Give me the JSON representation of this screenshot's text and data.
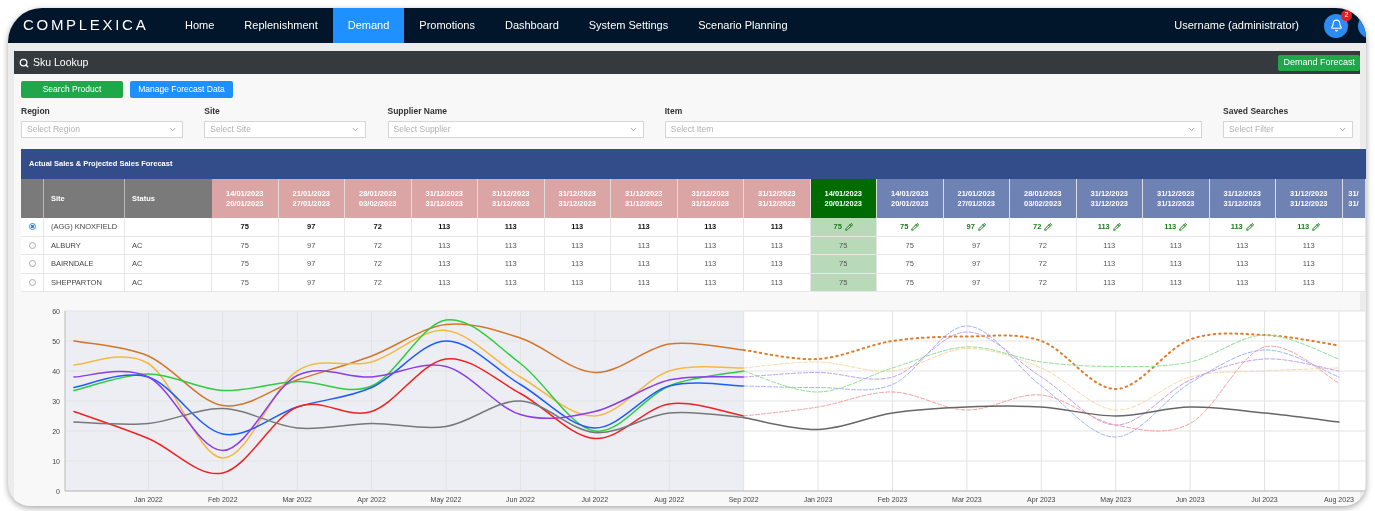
{
  "navbar": {
    "logo": "COMPLEXICA",
    "items": [
      {
        "label": "Home",
        "selected": false
      },
      {
        "label": "Replenishment",
        "selected": false
      },
      {
        "label": "Demand",
        "selected": true
      },
      {
        "label": "Promotions",
        "selected": false
      },
      {
        "label": "Dashboard",
        "selected": false
      },
      {
        "label": "System Settings",
        "selected": false
      },
      {
        "label": "Scenario Planning",
        "selected": false
      }
    ],
    "user": "Username (administrator)",
    "notification_count": "2"
  },
  "panel": {
    "title": "Sku Lookup",
    "header_button": "Demand Forecast",
    "buttons": [
      {
        "label": "Search Product",
        "kind": "primary"
      },
      {
        "label": "Manage Forecast Data",
        "kind": "secondary"
      }
    ],
    "filters": [
      {
        "label": "Region",
        "placeholder": "Select Region"
      },
      {
        "label": "Site",
        "placeholder": "Select Site"
      },
      {
        "label": "Supplier Name",
        "placeholder": "Select Supplier"
      },
      {
        "label": "Item",
        "placeholder": "Select Item"
      },
      {
        "label": "Saved Searches",
        "placeholder": "Select Filter"
      }
    ]
  },
  "table": {
    "title": "Actual Sales & Projected Sales Forecast",
    "site_header": "Site",
    "status_header": "Status",
    "columns": [
      {
        "kind": "actual",
        "start": "14/01/2023",
        "end": "20/01/2023"
      },
      {
        "kind": "actual",
        "start": "21/01/2023",
        "end": "27/01/2023"
      },
      {
        "kind": "actual",
        "start": "28/01/2023",
        "end": "03/02/2023"
      },
      {
        "kind": "actual",
        "start": "31/12/2023",
        "end": "31/12/2023"
      },
      {
        "kind": "actual",
        "start": "31/12/2023",
        "end": "31/12/2023"
      },
      {
        "kind": "actual",
        "start": "31/12/2023",
        "end": "31/12/2023"
      },
      {
        "kind": "actual",
        "start": "31/12/2023",
        "end": "31/12/2023"
      },
      {
        "kind": "actual",
        "start": "31/12/2023",
        "end": "31/12/2023"
      },
      {
        "kind": "actual",
        "start": "31/12/2023",
        "end": "31/12/2023"
      },
      {
        "kind": "current",
        "start": "14/01/2023",
        "end": "20/01/2023"
      },
      {
        "kind": "forecast",
        "start": "14/01/2023",
        "end": "20/01/2023"
      },
      {
        "kind": "forecast",
        "start": "21/01/2023",
        "end": "27/01/2023"
      },
      {
        "kind": "forecast",
        "start": "28/01/2023",
        "end": "03/02/2023"
      },
      {
        "kind": "forecast",
        "start": "31/12/2023",
        "end": "31/12/2023"
      },
      {
        "kind": "forecast",
        "start": "31/12/2023",
        "end": "31/12/2023"
      },
      {
        "kind": "forecast",
        "start": "31/12/2023",
        "end": "31/12/2023"
      },
      {
        "kind": "forecast",
        "start": "31/12/2023",
        "end": "31/12/2023"
      },
      {
        "kind": "forecast",
        "start": "31/",
        "end": "31/"
      }
    ],
    "rows": [
      {
        "selected": true,
        "kind": "aggregate",
        "site": "(AGG) KNOXFIELD",
        "cells": [
          "75",
          "97",
          "72",
          "113",
          "113",
          "113",
          "113",
          "113",
          "113",
          "75",
          "75",
          "97",
          "72",
          "113",
          "113",
          "113",
          "113"
        ]
      },
      {
        "selected": false,
        "kind": "site",
        "site": "ALBURY",
        "status": "AC",
        "cells": [
          "75",
          "97",
          "72",
          "113",
          "113",
          "113",
          "113",
          "113",
          "113",
          "75",
          "75",
          "97",
          "72",
          "113",
          "113",
          "113",
          "113"
        ]
      },
      {
        "selected": false,
        "kind": "site",
        "site": "BAIRNDALE",
        "status": "AC",
        "cells": [
          "75",
          "97",
          "72",
          "113",
          "113",
          "113",
          "113",
          "113",
          "113",
          "75",
          "75",
          "97",
          "72",
          "113",
          "113",
          "113",
          "113"
        ]
      },
      {
        "selected": false,
        "kind": "site",
        "site": "SHEPPARTON",
        "status": "AC",
        "cells": [
          "75",
          "97",
          "72",
          "113",
          "113",
          "113",
          "113",
          "113",
          "113",
          "75",
          "75",
          "97",
          "72",
          "113",
          "113",
          "113",
          "113"
        ]
      }
    ]
  },
  "chart": {
    "chart_data": {
      "type": "line",
      "categories": [
        null,
        "Jan 2022",
        "Feb 2022",
        "Mar 2022",
        "Apr 2022",
        "May 2022",
        "Jun 2022",
        "Jul 2022",
        "Aug 2022",
        "Sep 2022",
        "Jan 2023",
        "Feb 2023",
        "Mar 2023",
        "Apr 2023",
        "May 2023",
        "Jun 2023",
        "Jul 2023",
        "Aug 2023"
      ],
      "ylim": [
        0,
        60
      ],
      "grid": true,
      "yticks": [
        0,
        10,
        20,
        30,
        40,
        50,
        60
      ],
      "series": [
        {
          "color": "#d2772a",
          "line_style": "solid",
          "values": [
            50,
            45,
            28.5,
            37,
            45,
            55.5,
            51,
            39.5,
            49,
            47,
            null,
            null,
            null,
            null,
            null,
            null,
            null,
            null
          ]
        },
        {
          "color": "#f5b942",
          "line_style": "solid",
          "values": [
            42,
            42.5,
            11,
            40,
            43,
            53.5,
            38,
            25,
            40,
            41,
            null,
            null,
            null,
            null,
            null,
            null,
            null,
            null
          ]
        },
        {
          "color": "#2ecc40",
          "line_style": "solid",
          "values": [
            33.5,
            39,
            33.5,
            36.5,
            35,
            57,
            42.5,
            20,
            35,
            40,
            null,
            null,
            null,
            null,
            null,
            null,
            null,
            null
          ]
        },
        {
          "color": "#1f5cff",
          "line_style": "solid",
          "values": [
            34.5,
            38,
            19,
            28,
            34.5,
            50,
            35.5,
            21,
            35,
            35,
            null,
            null,
            null,
            null,
            null,
            null,
            null,
            null
          ]
        },
        {
          "color": "#8a3ee8",
          "line_style": "solid",
          "values": [
            38,
            38,
            13.5,
            38.5,
            38,
            41.5,
            25.5,
            26.5,
            37,
            38,
            null,
            null,
            null,
            null,
            null,
            null,
            null,
            null
          ]
        },
        {
          "color": "#ee2222",
          "line_style": "solid",
          "values": [
            26.5,
            17.5,
            6,
            28,
            26.5,
            44,
            32.5,
            17.5,
            29,
            25,
            null,
            null,
            null,
            null,
            null,
            null,
            null,
            null
          ]
        },
        {
          "color": "#777777",
          "line_style": "solid",
          "values": [
            23,
            22.5,
            27.5,
            21,
            22.5,
            21.5,
            30,
            19.5,
            26,
            24.5,
            null,
            null,
            null,
            null,
            null,
            null,
            null,
            null
          ]
        },
        {
          "color": "#e07b2a",
          "line_style": "dotted",
          "values": [
            null,
            null,
            null,
            null,
            null,
            null,
            null,
            null,
            null,
            47,
            44,
            50,
            51.5,
            50,
            34,
            50.5,
            52,
            48.5
          ]
        },
        {
          "color": "#f8d9a8",
          "line_style": "dashed",
          "values": [
            null,
            null,
            null,
            null,
            null,
            null,
            null,
            null,
            null,
            41,
            43,
            40,
            47.5,
            41,
            27,
            38,
            40,
            41
          ]
        },
        {
          "color": "#8ee08e",
          "line_style": "dashed",
          "values": [
            null,
            null,
            null,
            null,
            null,
            null,
            null,
            null,
            null,
            40,
            33,
            41,
            48,
            43,
            41.5,
            43,
            52,
            44
          ]
        },
        {
          "color": "#9fb4f5",
          "line_style": "dashed",
          "values": [
            null,
            null,
            null,
            null,
            null,
            null,
            null,
            null,
            null,
            35,
            34.5,
            35.5,
            55,
            35,
            18,
            36,
            47,
            38
          ]
        },
        {
          "color": "#c0a0f0",
          "line_style": "dashed",
          "values": [
            null,
            null,
            null,
            null,
            null,
            null,
            null,
            null,
            null,
            38,
            39.5,
            38,
            53,
            38,
            22,
            37,
            44,
            40
          ]
        },
        {
          "color": "#f3a0a0",
          "line_style": "dashed",
          "values": [
            null,
            null,
            null,
            null,
            null,
            null,
            null,
            null,
            null,
            25,
            28,
            33,
            27,
            32,
            22,
            22.5,
            48,
            36
          ]
        },
        {
          "color": "#666666",
          "line_style": "solid",
          "values": [
            null,
            null,
            null,
            null,
            null,
            null,
            null,
            null,
            null,
            24.5,
            20.5,
            26,
            28,
            28,
            25,
            28,
            26,
            23
          ]
        }
      ]
    }
  }
}
